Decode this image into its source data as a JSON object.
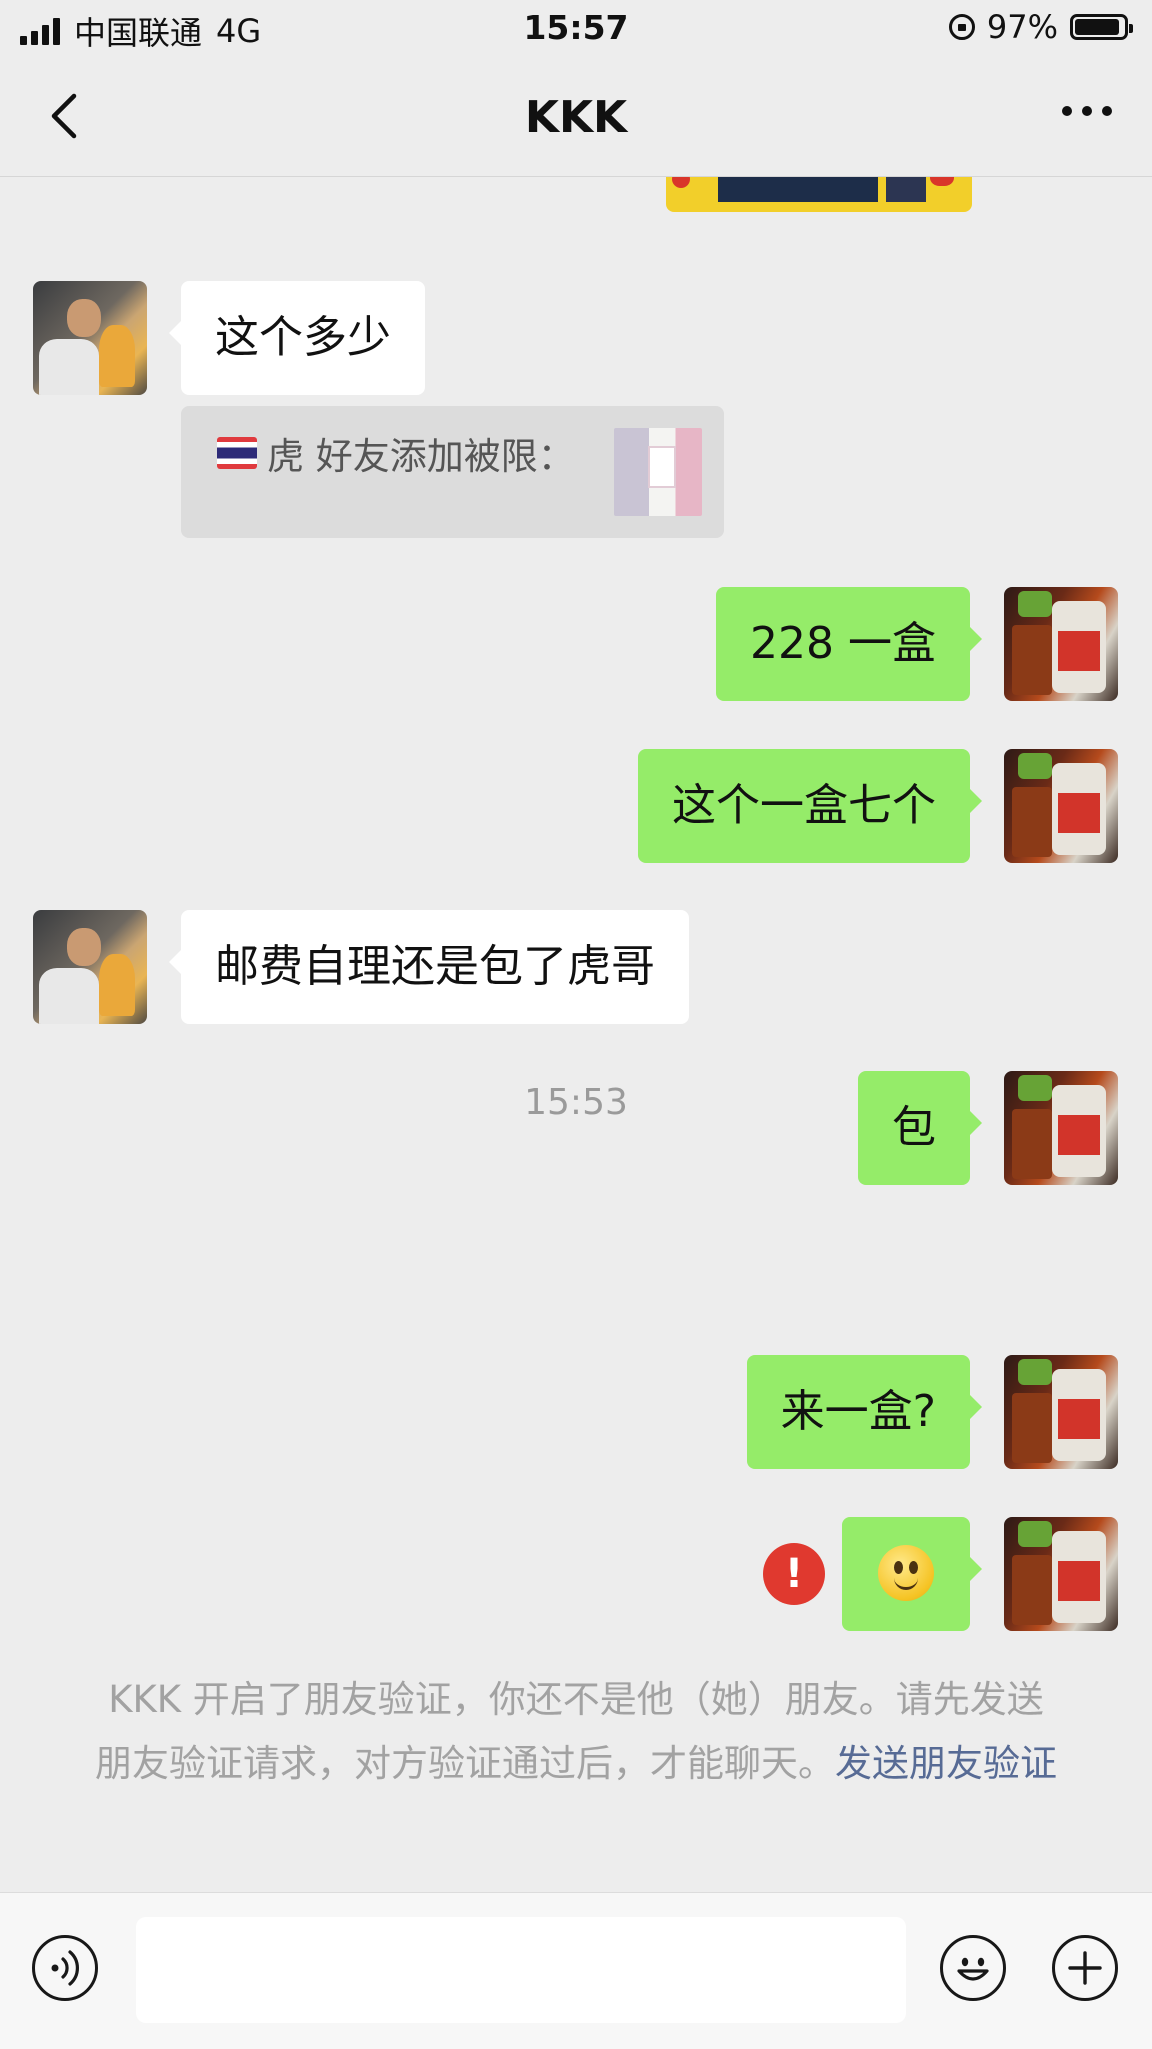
{
  "status_bar": {
    "carrier": "中国联通",
    "network": "4G",
    "time": "15:57",
    "battery": "97%"
  },
  "header": {
    "title": "KKK"
  },
  "messages": [
    {
      "side": "in",
      "text": "这个多少"
    },
    {
      "side": "in",
      "type": "quote",
      "text": "虎  好友添加被限："
    },
    {
      "side": "out",
      "text": "228 一盒"
    },
    {
      "side": "out",
      "text": "这个一盒七个"
    },
    {
      "side": "in",
      "text": "邮费自理还是包了虎哥"
    },
    {
      "side": "out",
      "text": "包"
    },
    {
      "side": "out",
      "text": "来一盒?"
    },
    {
      "side": "out",
      "type": "emoji",
      "emoji": "smile-emoji",
      "status": "failed"
    }
  ],
  "timestamp": "15:53",
  "notice": {
    "text": "KKK 开启了朋友验证，你还不是他（她）朋友。请先发送朋友验证请求，对方验证通过后，才能聊天。",
    "link": "发送朋友验证"
  },
  "input_bar": {
    "placeholder": ""
  },
  "colors": {
    "background": "#ededed",
    "outgoing_bubble": "#95ec69",
    "incoming_bubble": "#ffffff",
    "link": "#576b95",
    "error": "#e0392f"
  }
}
